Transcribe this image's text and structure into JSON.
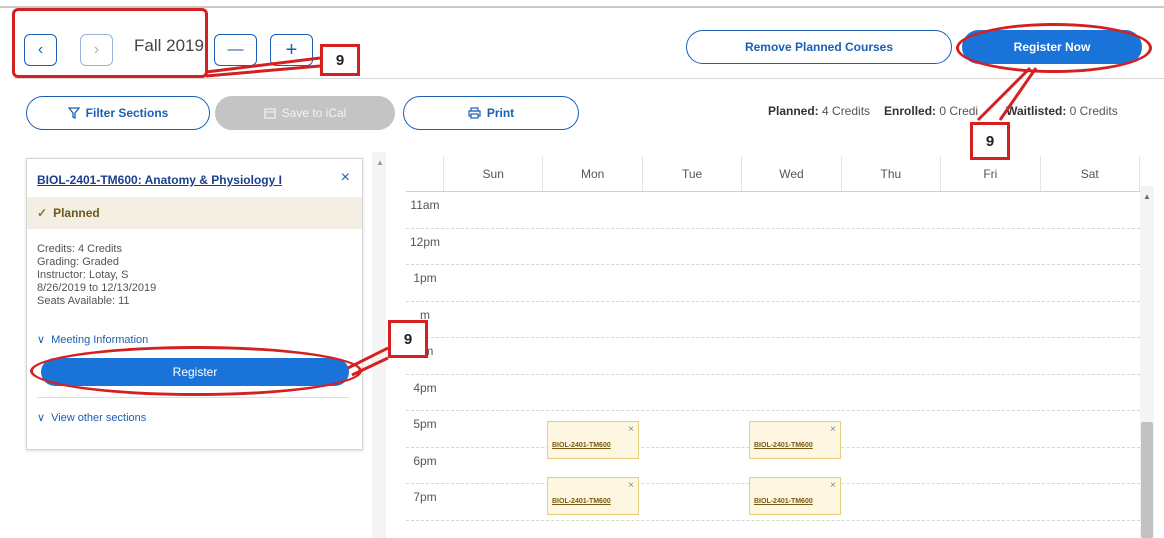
{
  "term": {
    "label": "Fall 2019",
    "prev_icon": "chevron-left-icon",
    "next_icon": "chevron-right-icon",
    "minus_label": "—",
    "plus_label": "+"
  },
  "toolbar": {
    "remove_planned": "Remove Planned Courses",
    "register_now": "Register Now",
    "filter_sections": "Filter Sections",
    "save_ical": "Save to iCal",
    "print": "Print"
  },
  "credits": {
    "planned_label": "Planned:",
    "planned_value": "4 Credits",
    "enrolled_label": "Enrolled:",
    "enrolled_value": "0 Credi",
    "waitlisted_label": "Waitlisted:",
    "waitlisted_value": "0 Credits"
  },
  "course_card": {
    "title": "BIOL-2401-TM600: Anatomy & Physiology I",
    "close": "×",
    "status": "Planned",
    "details": [
      "Credits: 4 Credits",
      "Grading: Graded",
      "Instructor: Lotay, S",
      "8/26/2019 to 12/13/2019",
      "Seats Available:  11"
    ],
    "meeting_info": "Meeting Information",
    "register": "Register",
    "view_other": "View other sections"
  },
  "calendar": {
    "days": [
      "Sun",
      "Mon",
      "Tue",
      "Wed",
      "Thu",
      "Fri",
      "Sat"
    ],
    "hours": [
      "11am",
      "12pm",
      "1pm",
      "2pm",
      "3pm",
      "4pm",
      "5pm",
      "6pm",
      "7pm"
    ],
    "hours_visible": [
      "11am",
      "12pm",
      "1pm",
      "m",
      "pm",
      "4pm",
      "5pm",
      "6pm",
      "7pm"
    ],
    "events": [
      {
        "label": "BIOL-2401-TM600",
        "close": "×"
      },
      {
        "label": "BIOL-2401-TM600",
        "close": "×"
      },
      {
        "label": "BIOL-2401-TM600",
        "close": "×"
      },
      {
        "label": "BIOL-2401-TM600",
        "close": "×"
      }
    ]
  },
  "annotations": {
    "step1": "9",
    "step2": "9",
    "step3": "9",
    "color": "#d42020"
  }
}
